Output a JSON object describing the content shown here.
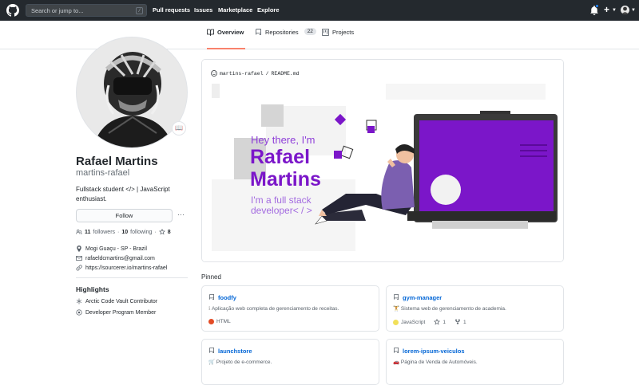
{
  "header": {
    "search_placeholder": "Search or jump to...",
    "slash_key": "/",
    "nav": [
      "Pull requests",
      "Issues",
      "Marketplace",
      "Explore"
    ],
    "plus_label": "+"
  },
  "tabs": [
    {
      "label": "Overview"
    },
    {
      "label": "Repositories",
      "count": "22"
    },
    {
      "label": "Projects"
    }
  ],
  "profile": {
    "badge_emoji": "📖",
    "full_name": "Rafael Martins",
    "username": "martins-rafael",
    "bio": "Fullstack student </> | JavaScript enthusiast.",
    "follow_label": "Follow",
    "more_label": "···",
    "followers_count": "11",
    "followers_label": "followers",
    "dot": "·",
    "following_count": "10",
    "following_label": "following",
    "dot2": "·",
    "stars_count": "8",
    "location": "Mogi Guaçu - SP - Brazil",
    "email": "rafaeldcmartins@gmail.com",
    "website": "https://sourcerer.io/martins-rafael"
  },
  "highlights": {
    "title": "Highlights",
    "items": [
      "Arctic Code Vault Contributor",
      "Developer Program Member"
    ]
  },
  "readme": {
    "user": "martins-rafael",
    "sep": "/",
    "file": "README.md",
    "greeting": "Hey there, I'm",
    "name_line1": "Rafael",
    "name_line2": "Martins",
    "role_line1": "I'm a full stack",
    "role_line2": "developer< / >"
  },
  "pinned": {
    "title": "Pinned",
    "cards": [
      {
        "name": "foodfy",
        "desc": "Aplicação web completa de gerenciamento de receitas.",
        "desc_icon": "ℹ",
        "language": "HTML",
        "lang_color": "#e34c26"
      },
      {
        "name": "gym-manager",
        "desc": "Sistema web de gerenciamento de academia.",
        "desc_icon": "🏋",
        "language": "JavaScript",
        "lang_color": "#f1e05a",
        "stars": "1",
        "forks": "1"
      },
      {
        "name": "launchstore",
        "desc": "Projeto de e-commerce.",
        "desc_icon": "🛒",
        "language": "",
        "lang_color": ""
      },
      {
        "name": "lorem-ipsum-veiculos",
        "desc": "Página de Venda de Automóveis.",
        "desc_icon": "🚗",
        "language": "",
        "lang_color": ""
      }
    ]
  },
  "colors": {
    "header_bg": "#24292e",
    "active_tab_underline": "#f9826c",
    "link": "#0366d6",
    "banner_purple": "#7b16c9"
  }
}
